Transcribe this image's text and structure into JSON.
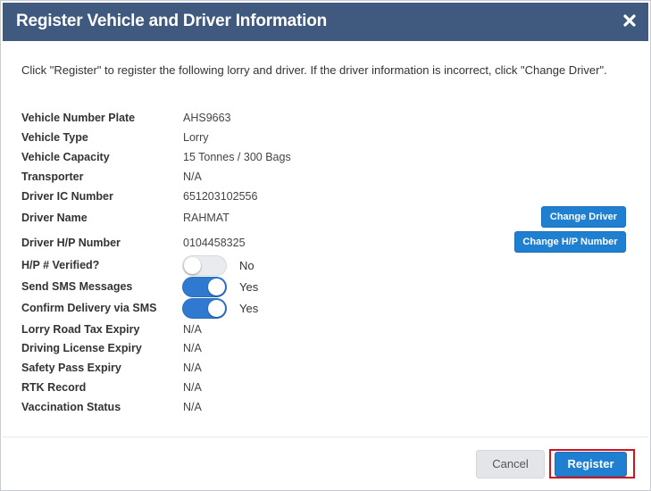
{
  "dialog": {
    "title": "Register Vehicle and Driver Information",
    "close_icon": "close-icon",
    "intro": "Click \"Register\" to register the following lorry and driver.  If the driver information is incorrect, click \"Change Driver\"."
  },
  "fields": {
    "vehicle_number_plate": {
      "label": "Vehicle Number Plate",
      "value": "AHS9663"
    },
    "vehicle_type": {
      "label": "Vehicle Type",
      "value": "Lorry"
    },
    "vehicle_capacity": {
      "label": "Vehicle Capacity",
      "value": "15 Tonnes / 300 Bags"
    },
    "transporter": {
      "label": "Transporter",
      "value": "N/A"
    },
    "driver_ic_number": {
      "label": "Driver IC Number",
      "value": "651203102556"
    },
    "driver_name": {
      "label": "Driver Name",
      "value": "RAHMAT"
    },
    "driver_hp_number": {
      "label": "Driver H/P Number",
      "value": "0104458325"
    },
    "hp_verified": {
      "label": "H/P # Verified?",
      "toggle_on": false,
      "value": "No"
    },
    "send_sms": {
      "label": "Send SMS Messages",
      "toggle_on": true,
      "value": "Yes"
    },
    "confirm_delivery_sms": {
      "label": "Confirm Delivery via SMS",
      "toggle_on": true,
      "value": "Yes"
    },
    "lorry_road_tax_expiry": {
      "label": "Lorry Road Tax Expiry",
      "value": "N/A"
    },
    "driving_license_expiry": {
      "label": "Driving License Expiry",
      "value": "N/A"
    },
    "safety_pass_expiry": {
      "label": "Safety Pass Expiry",
      "value": "N/A"
    },
    "rtk_record": {
      "label": "RTK Record",
      "value": "N/A"
    },
    "vaccination_status": {
      "label": "Vaccination Status",
      "value": "N/A"
    }
  },
  "buttons": {
    "change_driver": "Change Driver",
    "change_hp": "Change H/P Number",
    "cancel": "Cancel",
    "register": "Register"
  },
  "colors": {
    "header_bg": "#3f5a7e",
    "primary_button": "#1f7fd1",
    "toggle_on": "#2f7ad0",
    "highlight_outline": "#d0141c"
  }
}
